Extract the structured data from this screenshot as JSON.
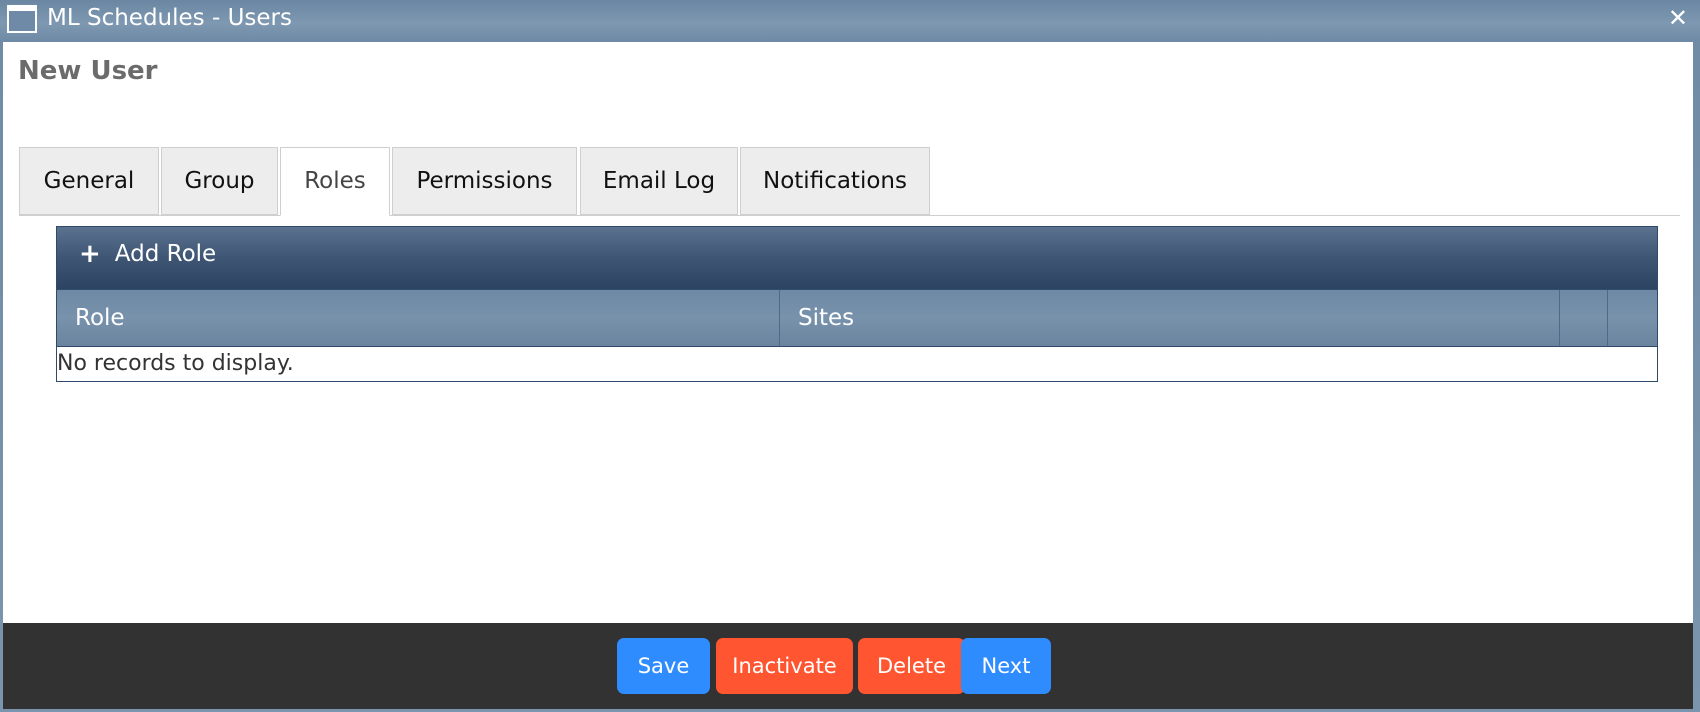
{
  "window": {
    "title": "ML Schedules - Users",
    "close_label": "✕"
  },
  "page": {
    "title": "New User"
  },
  "tabs": [
    {
      "label": "General",
      "active": false
    },
    {
      "label": "Group",
      "active": false
    },
    {
      "label": "Roles",
      "active": true
    },
    {
      "label": "Permissions",
      "active": false
    },
    {
      "label": "Email Log",
      "active": false
    },
    {
      "label": "Notifications",
      "active": false
    }
  ],
  "grid": {
    "add_label": "Add Role",
    "add_icon": "+",
    "columns": [
      "Role",
      "Sites",
      "",
      ""
    ],
    "empty_message": "No records to display."
  },
  "footer": {
    "buttons": [
      {
        "label": "Save",
        "color": "#2f8cff"
      },
      {
        "label": "Inactivate",
        "color": "#ff5530"
      },
      {
        "label": "Delete",
        "color": "#ff5530"
      },
      {
        "label": "Next",
        "color": "#2f8cff"
      }
    ]
  },
  "colors": {
    "titlebar": "#7e98b1",
    "grid_toolbar": "#3e5674",
    "grid_header": "#7892ac",
    "footer": "#323232",
    "primary": "#2f8cff",
    "danger": "#ff5530"
  }
}
